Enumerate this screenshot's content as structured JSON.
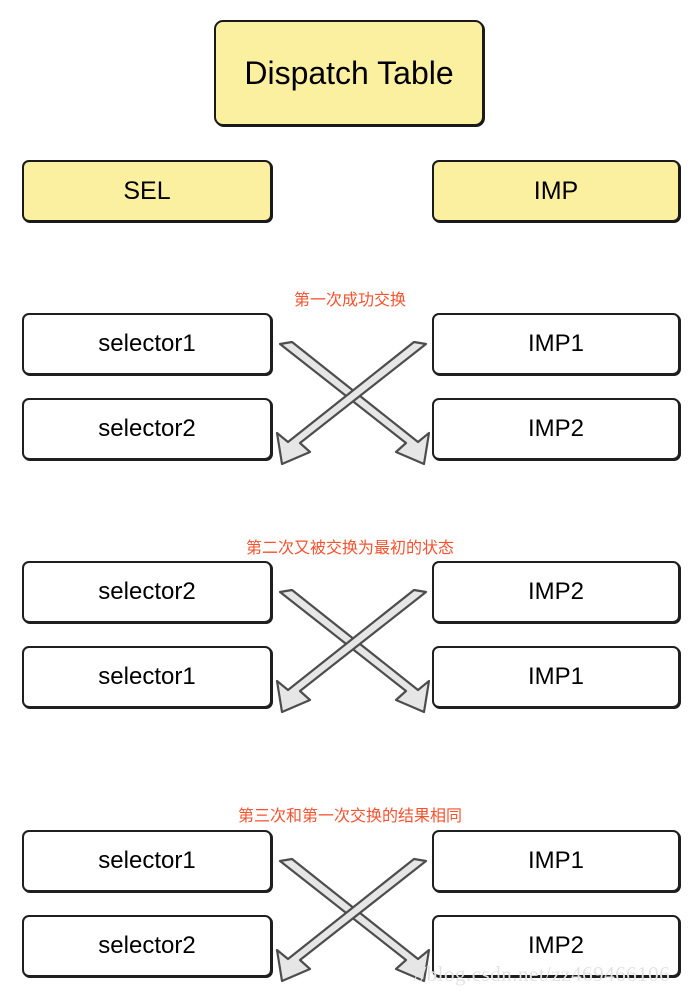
{
  "title": {
    "label": "Dispatch Table"
  },
  "columns": {
    "left_header": "SEL",
    "right_header": "IMP"
  },
  "groups": [
    {
      "annotation": "第一次成功交换",
      "left": [
        "selector1",
        "selector2"
      ],
      "right": [
        "IMP1",
        "IMP2"
      ]
    },
    {
      "annotation": "第二次又被交换为最初的状态",
      "left": [
        "selector2",
        "selector1"
      ],
      "right": [
        "IMP2",
        "IMP1"
      ]
    },
    {
      "annotation": "第三次和第一次交换的结果相同",
      "left": [
        "selector1",
        "selector2"
      ],
      "right": [
        "IMP1",
        "IMP2"
      ]
    }
  ],
  "watermark": "//blog.csdn.net/zz469466106",
  "colors": {
    "header_fill": "#FBF0A0",
    "box_fill": "#FFFFFF",
    "box_border": "#1F1F1F",
    "annotation": "#F7512E",
    "arrow_fill": "#E6E6E6",
    "arrow_stroke": "#4D4D4D",
    "watermark": "#E3E3E3"
  }
}
